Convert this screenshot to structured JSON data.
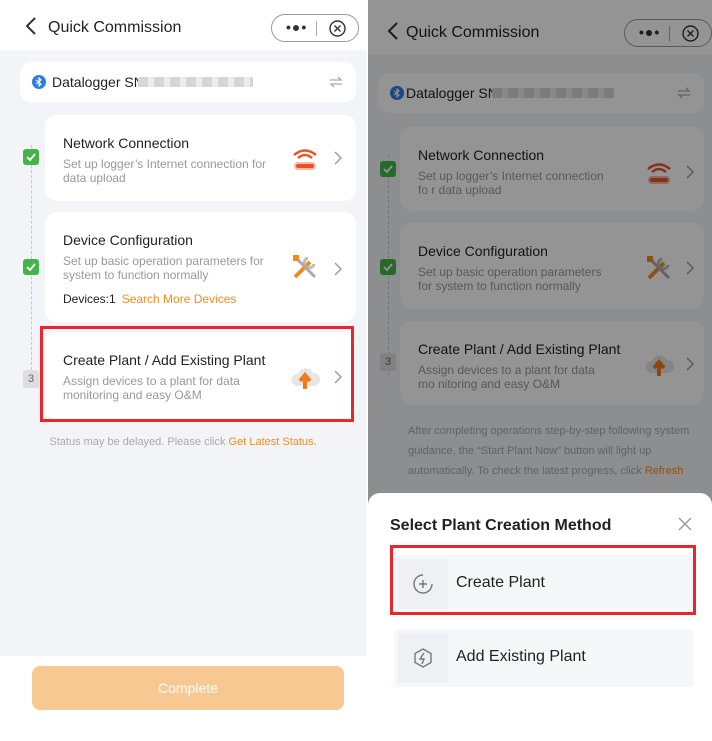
{
  "left": {
    "nav": {
      "title": "Quick Commission",
      "more_glyph": "•●•"
    },
    "sn": {
      "label": "Datalogger SN:"
    },
    "steps": [
      {
        "title": "Network Connection",
        "desc": "Set up logger’s Internet connection for data upload",
        "status": "done",
        "icon": "wifi-router-icon"
      },
      {
        "title": "Device Configuration",
        "desc": "Set up basic operation parameters for system to function normally",
        "status": "done",
        "icon": "tools-icon",
        "devices_label": "Devices:1",
        "search_more": "Search More Devices"
      },
      {
        "title": "Create Plant / Add Existing Plant",
        "desc": "Assign devices to a plant for data monitoring and easy O&M",
        "status": "3",
        "icon": "cloud-upload-icon"
      }
    ],
    "status_text": "Status may be delayed. Please click",
    "status_link": "Get Latest Status.",
    "complete_label": "Complete"
  },
  "right": {
    "nav": {
      "title": "Quick Commission",
      "more_glyph": "•●•"
    },
    "sn": {
      "label": "Datalogger SN"
    },
    "steps": [
      {
        "title": "Network Connection",
        "desc": "Set up logger’s Internet connection fo r data upload",
        "status": "done"
      },
      {
        "title": "Device Configuration",
        "desc": "Set up basic operation parameters for system to function normally",
        "status": "done"
      },
      {
        "title": "Create Plant / Add Existing Plant",
        "desc": "Assign devices to a plant for data mo nitoring and easy O&M",
        "status": "3"
      }
    ],
    "footer_text": "After completing operations step-by-step following system guidance, the “Start Plant Now” button will light up automatically. To check the latest progress, click",
    "footer_link": "Refresh",
    "sheet": {
      "title": "Select Plant Creation Method",
      "options": [
        {
          "label": "Create Plant",
          "icon": "plus-circle-icon"
        },
        {
          "label": "Add Existing Plant",
          "icon": "plant-link-icon"
        }
      ]
    }
  },
  "colors": {
    "accent": "#f08c1e",
    "check": "#44b34a",
    "highlight": "#e8262c",
    "complete_button": "#f7c891"
  }
}
